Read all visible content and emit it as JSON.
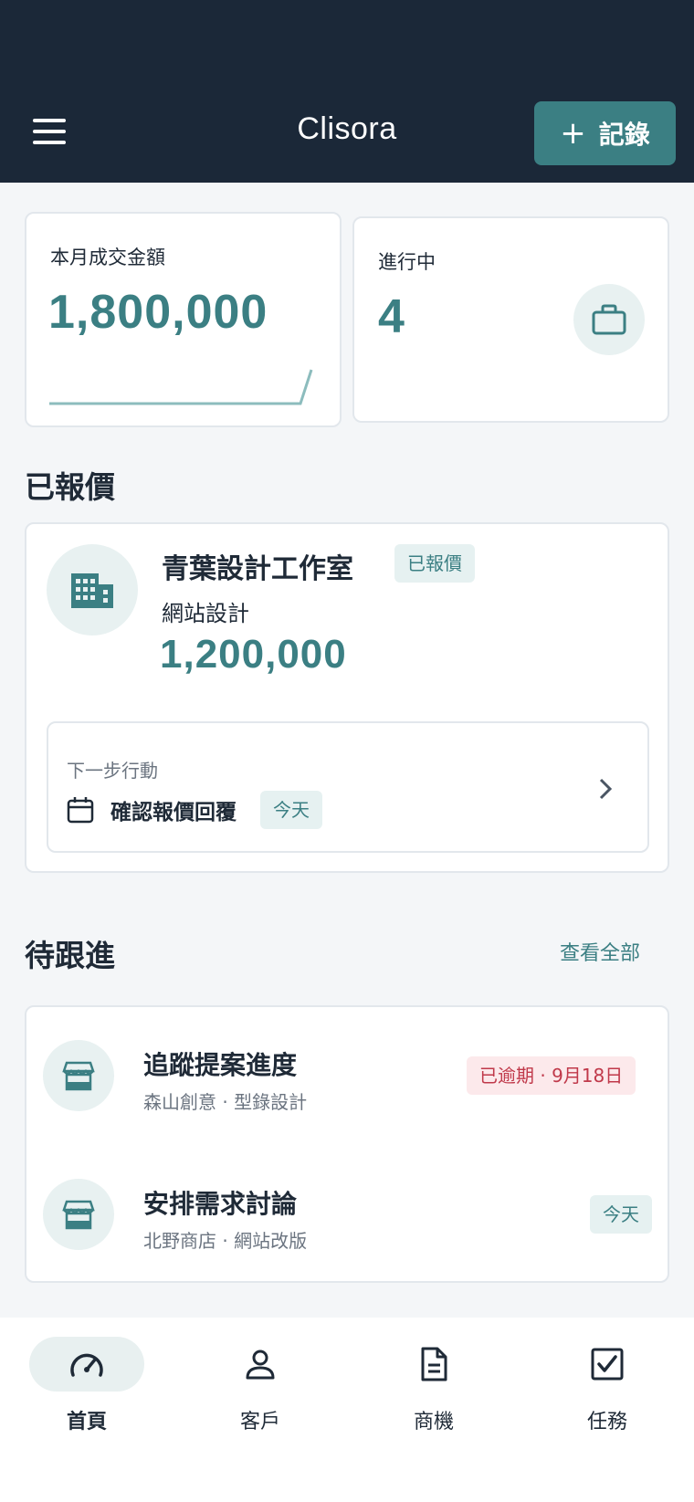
{
  "header": {
    "title": "Clisora",
    "record_button": "記錄"
  },
  "stats": {
    "monthly_deal": {
      "label": "本月成交金額",
      "value": "1,800,000"
    },
    "in_progress": {
      "label": "進行中",
      "value": "4"
    }
  },
  "quoted": {
    "section_title": "已報價",
    "company": "青葉設計工作室",
    "status_tag": "已報價",
    "project": "網站設計",
    "amount": "1,200,000",
    "next_action": {
      "label": "下一步行動",
      "task": "確認報價回覆",
      "due": "今天"
    }
  },
  "follow_up": {
    "section_title": "待跟進",
    "view_all": "查看全部",
    "items": [
      {
        "title": "追蹤提案進度",
        "subtitle": "森山創意 · 型錄設計",
        "tag": "已逾期 · 9月18日"
      },
      {
        "title": "安排需求討論",
        "subtitle": "北野商店 · 網站改版",
        "tag": "今天"
      }
    ]
  },
  "nav": {
    "items": [
      {
        "label": "首頁",
        "icon": "gauge-icon",
        "active": true
      },
      {
        "label": "客戶",
        "icon": "person-icon"
      },
      {
        "label": "商機",
        "icon": "document-icon"
      },
      {
        "label": "任務",
        "icon": "checkbox-icon"
      }
    ]
  },
  "colors": {
    "header_bg": "#1b2838",
    "accent": "#3b7f83",
    "overdue": "#c0394a",
    "page_bg": "#f4f6f8"
  }
}
